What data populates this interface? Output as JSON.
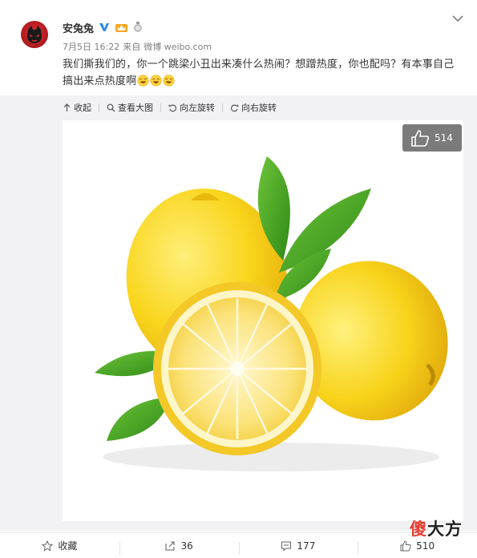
{
  "user": {
    "name": "安兔兔"
  },
  "meta": {
    "date": "7月5日 16:22",
    "via": "来自",
    "source": "微博 weibo.com"
  },
  "post": {
    "text": "我们撕我们的，你一个跳梁小丑出来凑什么热闹？想蹭热度，你也配吗？有本事自己搞出来点热度啊",
    "emoji": [
      "馋嘴",
      "馋嘴",
      "馋嘴"
    ]
  },
  "media_toolbar": {
    "collapse": "收起",
    "view_large": "查看大图",
    "rotate_left": "向左旋转",
    "rotate_right": "向右旋转"
  },
  "image": {
    "subject": "lemons",
    "like_count": "514"
  },
  "actions": {
    "favorite": "收藏",
    "repost_count": "36",
    "comment_count": "177",
    "like_count": "510"
  },
  "watermark": {
    "part1": "傻",
    "part2": "大方"
  },
  "colors": {
    "panel_bg": "#f2f2f5",
    "verified_blue": "#2c8ae8",
    "link_gray": "#808080"
  }
}
